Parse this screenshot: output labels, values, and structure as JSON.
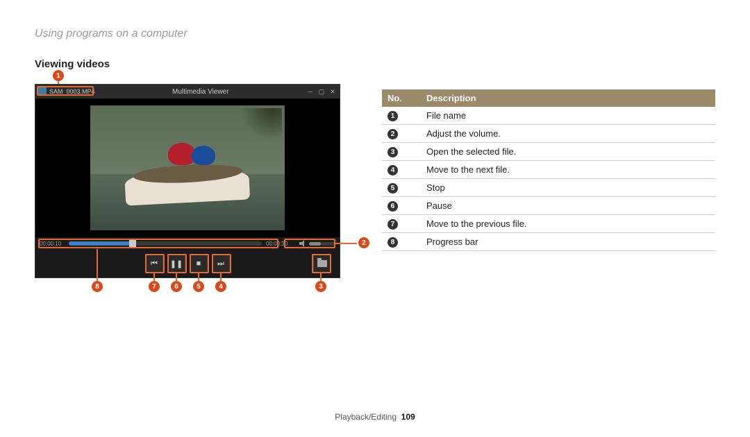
{
  "breadcrumb": "Using programs on a computer",
  "section_title": "Viewing videos",
  "player": {
    "filename": "SAM_0003.MP4",
    "app_title": "Multimedia Viewer",
    "time_elapsed": "00:00:10",
    "time_total": "00:00:30"
  },
  "callouts": {
    "c1": "1",
    "c2": "2",
    "c3": "3",
    "c4": "4",
    "c5": "5",
    "c6": "6",
    "c7": "7",
    "c8": "8"
  },
  "table": {
    "headers": {
      "no": "No.",
      "desc": "Description"
    },
    "rows": [
      {
        "n": "1",
        "d": "File name"
      },
      {
        "n": "2",
        "d": "Adjust the volume."
      },
      {
        "n": "3",
        "d": "Open the selected file."
      },
      {
        "n": "4",
        "d": "Move to the next file."
      },
      {
        "n": "5",
        "d": "Stop"
      },
      {
        "n": "6",
        "d": "Pause"
      },
      {
        "n": "7",
        "d": "Move to the previous file."
      },
      {
        "n": "8",
        "d": "Progress bar"
      }
    ]
  },
  "footer": {
    "section": "Playback/Editing",
    "page": "109"
  }
}
